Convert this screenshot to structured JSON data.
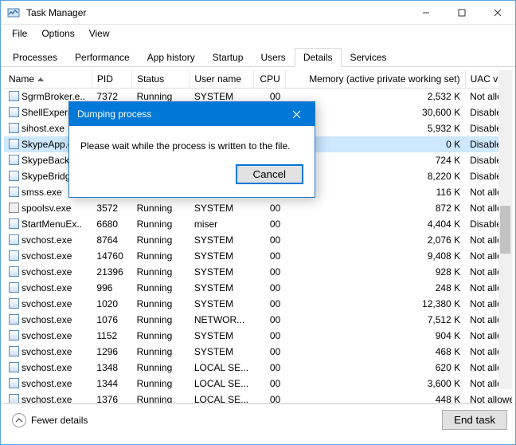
{
  "window": {
    "title": "Task Manager",
    "menu": [
      "File",
      "Options",
      "View"
    ],
    "controls": {
      "min": "–",
      "max": "▢",
      "close": "✕"
    }
  },
  "tabs": {
    "items": [
      "Processes",
      "Performance",
      "App history",
      "Startup",
      "Users",
      "Details",
      "Services"
    ],
    "active_index": 5
  },
  "columns": {
    "name": "Name",
    "pid": "PID",
    "status": "Status",
    "user": "User name",
    "cpu": "CPU",
    "mem": "Memory (active private working set)",
    "uac": "UAC virtualizat"
  },
  "rows": [
    {
      "name": "SgrmBroker.e..",
      "pid": "7372",
      "status": "Running",
      "user": "SYSTEM",
      "cpu": "00",
      "mem": "2,532 K",
      "uac": "Not allowed",
      "icon": "app",
      "selected": false
    },
    {
      "name": "ShellExperien",
      "pid": "",
      "status": "",
      "user": "",
      "cpu": "",
      "mem": "30,600 K",
      "uac": "Disabled",
      "icon": "app",
      "selected": false
    },
    {
      "name": "sihost.exe",
      "pid": "",
      "status": "",
      "user": "",
      "cpu": "",
      "mem": "5,932 K",
      "uac": "Disabled",
      "icon": "app",
      "selected": false
    },
    {
      "name": "SkypeApp.ex",
      "pid": "",
      "status": "",
      "user": "",
      "cpu": "",
      "mem": "0 K",
      "uac": "Disabled",
      "icon": "app",
      "selected": true
    },
    {
      "name": "SkypeBackgr",
      "pid": "",
      "status": "",
      "user": "",
      "cpu": "",
      "mem": "724 K",
      "uac": "Disabled",
      "icon": "app",
      "selected": false
    },
    {
      "name": "SkypeBridge.",
      "pid": "",
      "status": "",
      "user": "",
      "cpu": "",
      "mem": "8,220 K",
      "uac": "Disabled",
      "icon": "app",
      "selected": false
    },
    {
      "name": "smss.exe",
      "pid": "",
      "status": "",
      "user": "",
      "cpu": "",
      "mem": "116 K",
      "uac": "Not allowed",
      "icon": "app",
      "selected": false
    },
    {
      "name": "spoolsv.exe",
      "pid": "3572",
      "status": "Running",
      "user": "SYSTEM",
      "cpu": "00",
      "mem": "872 K",
      "uac": "Not allowed",
      "icon": "gear",
      "selected": false
    },
    {
      "name": "StartMenuEx..",
      "pid": "6680",
      "status": "Running",
      "user": "miser",
      "cpu": "00",
      "mem": "4,404 K",
      "uac": "Disabled",
      "icon": "app",
      "selected": false
    },
    {
      "name": "svchost.exe",
      "pid": "8764",
      "status": "Running",
      "user": "SYSTEM",
      "cpu": "00",
      "mem": "2,076 K",
      "uac": "Not allowed",
      "icon": "app",
      "selected": false
    },
    {
      "name": "svchost.exe",
      "pid": "14760",
      "status": "Running",
      "user": "SYSTEM",
      "cpu": "00",
      "mem": "9,408 K",
      "uac": "Not allowed",
      "icon": "app",
      "selected": false
    },
    {
      "name": "svchost.exe",
      "pid": "21396",
      "status": "Running",
      "user": "SYSTEM",
      "cpu": "00",
      "mem": "928 K",
      "uac": "Not allowed",
      "icon": "app",
      "selected": false
    },
    {
      "name": "svchost.exe",
      "pid": "996",
      "status": "Running",
      "user": "SYSTEM",
      "cpu": "00",
      "mem": "248 K",
      "uac": "Not allowed",
      "icon": "app",
      "selected": false
    },
    {
      "name": "svchost.exe",
      "pid": "1020",
      "status": "Running",
      "user": "SYSTEM",
      "cpu": "00",
      "mem": "12,380 K",
      "uac": "Not allowed",
      "icon": "app",
      "selected": false
    },
    {
      "name": "svchost.exe",
      "pid": "1076",
      "status": "Running",
      "user": "NETWOR...",
      "cpu": "00",
      "mem": "7,512 K",
      "uac": "Not allowed",
      "icon": "app",
      "selected": false
    },
    {
      "name": "svchost.exe",
      "pid": "1152",
      "status": "Running",
      "user": "SYSTEM",
      "cpu": "00",
      "mem": "904 K",
      "uac": "Not allowed",
      "icon": "app",
      "selected": false
    },
    {
      "name": "svchost.exe",
      "pid": "1296",
      "status": "Running",
      "user": "SYSTEM",
      "cpu": "00",
      "mem": "468 K",
      "uac": "Not allowed",
      "icon": "app",
      "selected": false
    },
    {
      "name": "svchost.exe",
      "pid": "1348",
      "status": "Running",
      "user": "LOCAL SE...",
      "cpu": "00",
      "mem": "620 K",
      "uac": "Not allowed",
      "icon": "app",
      "selected": false
    },
    {
      "name": "svchost.exe",
      "pid": "1344",
      "status": "Running",
      "user": "LOCAL SE...",
      "cpu": "00",
      "mem": "3,600 K",
      "uac": "Not allowed",
      "icon": "app",
      "selected": false
    },
    {
      "name": "svchost.exe",
      "pid": "1376",
      "status": "Running",
      "user": "LOCAL SE...",
      "cpu": "00",
      "mem": "448 K",
      "uac": "Not allowed",
      "icon": "app",
      "selected": false
    }
  ],
  "footer": {
    "fewer": "Fewer details",
    "endtask": "End task"
  },
  "dialog": {
    "title": "Dumping process",
    "message": "Please wait while the process is written to the file.",
    "cancel": "Cancel",
    "close_glyph": "✕"
  }
}
